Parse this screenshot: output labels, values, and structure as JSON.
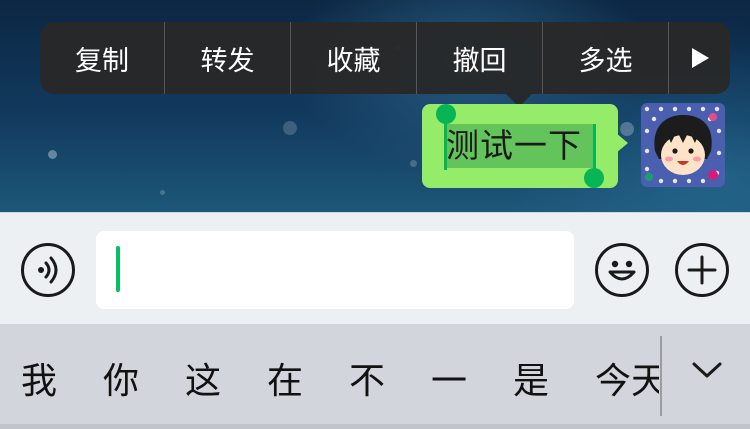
{
  "context_menu": {
    "items": [
      "复制",
      "转发",
      "收藏",
      "撤回",
      "多选"
    ],
    "more_icon": "play-right-icon"
  },
  "message": {
    "text": "测试一下",
    "bubble_color": "#95ec69",
    "selected": true
  },
  "avatar": {
    "icon": "cartoon-girl-avatar"
  },
  "input_bar": {
    "voice_icon": "voice-icon",
    "emoji_icon": "smiley-face-icon",
    "plus_icon": "plus-icon",
    "text_value": ""
  },
  "keyboard": {
    "candidates": [
      "我",
      "你",
      "这",
      "在",
      "不",
      "一",
      "是",
      "今天"
    ],
    "collapse_icon": "chevron-down-icon"
  },
  "colors": {
    "accent": "#07c160",
    "menu_bg": "#282828",
    "input_bar_bg": "#edf0f3",
    "keyboard_bg": "#d2d5db"
  }
}
